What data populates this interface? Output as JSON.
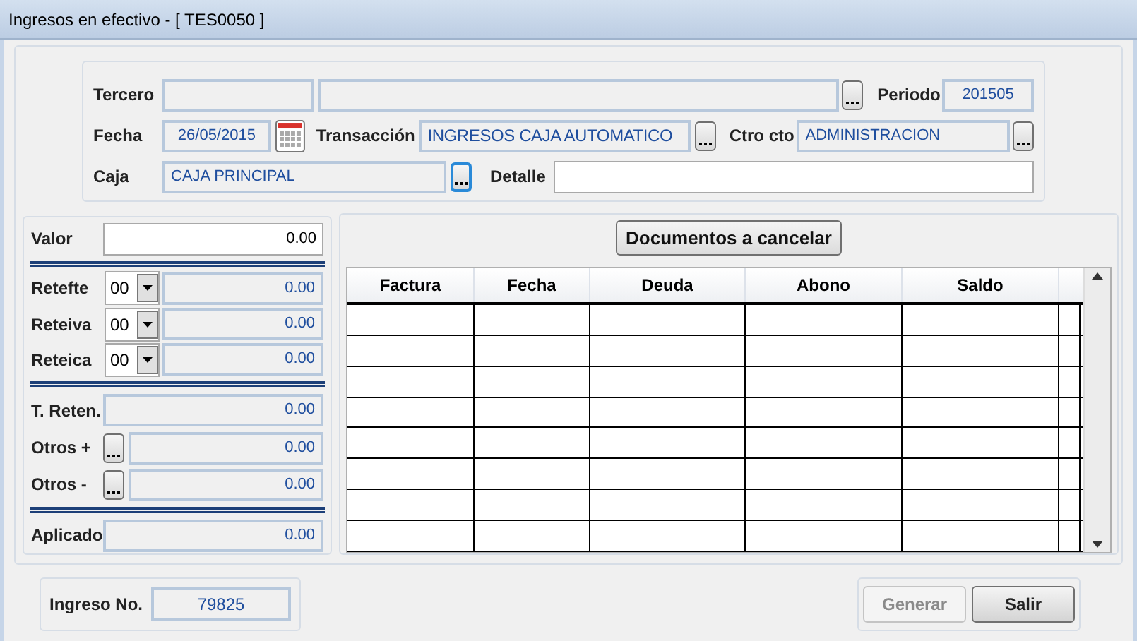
{
  "window": {
    "title": "Ingresos en efectivo - [ TES0050 ]"
  },
  "header": {
    "tercero": {
      "label": "Tercero",
      "editable": false
    },
    "periodo": {
      "label": "Periodo",
      "value": "201505",
      "editable": false
    },
    "fecha": {
      "label": "Fecha",
      "value": "26/05/2015",
      "editable": false
    },
    "transaccion": {
      "label": "Transacción",
      "value": "INGRESOS CAJA AUTOMATICO",
      "editable": false
    },
    "ctro_cto": {
      "label": "Ctro cto",
      "value": "ADMINISTRACION",
      "editable": false
    },
    "caja": {
      "label": "Caja",
      "value": "CAJA PRINCIPAL",
      "editable": false
    },
    "detalle": {
      "label": "Detalle",
      "editable": true
    }
  },
  "amounts": {
    "valor": {
      "label": "Valor",
      "value": "0.00",
      "editable": true
    },
    "retentions": [
      {
        "label": "Retefte",
        "code": "00",
        "value": "0.00"
      },
      {
        "label": "Reteiva",
        "code": "00",
        "value": "0.00"
      },
      {
        "label": "Reteica",
        "code": "00",
        "value": "0.00"
      }
    ],
    "t_reten": {
      "label": "T. Reten.",
      "value": "0.00"
    },
    "otros": [
      {
        "label": "Otros +",
        "value": "0.00"
      },
      {
        "label": "Otros -",
        "value": "0.00"
      }
    ],
    "aplicado": {
      "label": "Aplicado",
      "value": "0.00"
    }
  },
  "documents_button": "Documentos a cancelar",
  "table": {
    "columns": [
      "Factura",
      "Fecha",
      "Deuda",
      "Abono",
      "Saldo"
    ]
  },
  "ingreso": {
    "label": "Ingreso No.",
    "value": "79825"
  },
  "buttons": [
    {
      "label": "Generar",
      "disabled": true
    },
    {
      "label": "Salir",
      "disabled": false
    }
  ]
}
